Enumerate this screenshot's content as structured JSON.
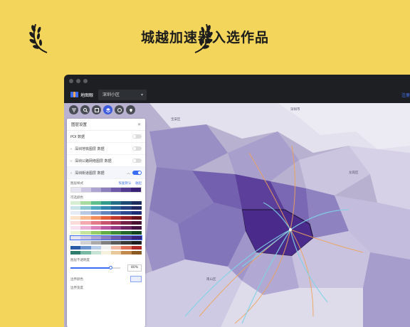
{
  "banner": {
    "title": "城越加速器入选作品"
  },
  "window": {
    "app_name": "地图眼",
    "district_select": "深圳小区",
    "toolbar_link": "注册"
  },
  "tools": [
    {
      "name": "filter-icon"
    },
    {
      "name": "search-icon"
    },
    {
      "name": "map-icon"
    },
    {
      "name": "layers-icon"
    },
    {
      "name": "compass-icon"
    },
    {
      "name": "location-pin-icon"
    }
  ],
  "panel": {
    "title": "图层设置",
    "close": "✕",
    "layers": [
      {
        "label": "POI 数据",
        "on": false
      },
      {
        "label": "深圳地铁图层 数据",
        "on": false
      },
      {
        "label": "深圳公路网络图层 数据",
        "on": false
      },
      {
        "label": "深圳街道图层 数据",
        "on": true
      }
    ],
    "color_scheme_label": "图层样式",
    "color_links": [
      "恢复默认",
      "收起"
    ],
    "palette_label": "可选颜色",
    "opacity_label": "图层不透明度",
    "opacity_value": "80%",
    "opacity_fraction": 0.8,
    "border_color_label": "边界颜色",
    "border_width_label": "边界宽度"
  },
  "current_ramp": [
    "#e7e4f1",
    "#cdc7e3",
    "#aea4d1",
    "#8d7fbe",
    "#6e5aa8",
    "#513a8f",
    "#3a2276"
  ],
  "palettes": [
    [
      "#d7eed2",
      "#a7dba0",
      "#5fbf8c",
      "#2e9b8b",
      "#216e86",
      "#1d4a75",
      "#1a2d5e"
    ],
    [
      "#c9e4e8",
      "#8cc7d4",
      "#4fa8c0",
      "#2f83ad",
      "#275f97",
      "#223f7f",
      "#1f2760"
    ],
    [
      "#e6ecf6",
      "#b9c9e4",
      "#8ca6d1",
      "#6384bd",
      "#4364a7",
      "#2d4690",
      "#1e2e76"
    ],
    [
      "#fde2c9",
      "#f9b98c",
      "#f38b5a",
      "#e35d3a",
      "#c23a2d",
      "#951f26",
      "#68121d"
    ],
    [
      "#fbdada",
      "#f3a9ae",
      "#e27a88",
      "#c9546e",
      "#a23558",
      "#741f45",
      "#4b1232"
    ],
    [
      "#f8e0ef",
      "#ecb0d6",
      "#d97fbc",
      "#bb56a0",
      "#933882",
      "#6a2262",
      "#431343"
    ],
    [
      "#e9f4d3",
      "#c5e39c",
      "#95cc68",
      "#64ad46",
      "#3f8a36",
      "#26672c",
      "#134520"
    ],
    [
      "#e7e4f1",
      "#cdc7e3",
      "#aea4d1",
      "#8d7fbe",
      "#6e5aa8",
      "#513a8f",
      "#3a2276"
    ],
    [
      "#f2f2f2",
      "#d1d1d1",
      "#aaaaaa",
      "#808080",
      "#5a5a5a",
      "#383838",
      "#1d1d1d"
    ],
    [
      "#2b5ca8",
      "#6c94cf",
      "#b7cde9",
      "#f1f1f1",
      "#f3b9a5",
      "#de6f55",
      "#b22a26"
    ],
    [
      "#2e7d6d",
      "#79b8a3",
      "#c6e3d6",
      "#f6f1dc",
      "#e9c89a",
      "#c28a4d",
      "#8b5a22"
    ]
  ],
  "map": {
    "labels": [
      "深圳市",
      "宝安区",
      "龙岗区",
      "南山区"
    ],
    "colors": {
      "light": "#d8d4e6",
      "mid": "#a59bc8",
      "dark": "#6e5aa8",
      "deep": "#4e2f8f",
      "flow_orange": "#f0a45a",
      "flow_blue": "#7fd3e6"
    }
  }
}
